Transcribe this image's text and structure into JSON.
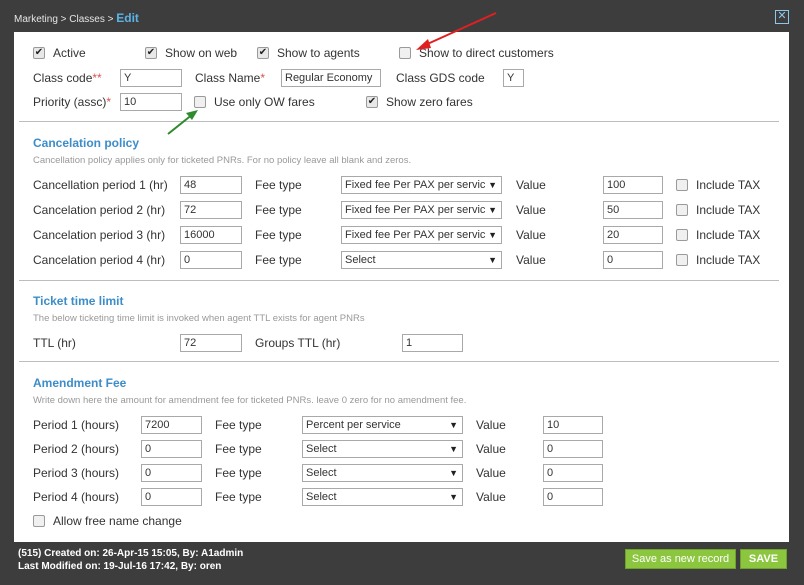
{
  "breadcrumb": {
    "path": "Marketing > Classes > ",
    "current": "Edit"
  },
  "flags": {
    "active": "Active",
    "show_on_web": "Show on web",
    "show_to_agents": "Show to agents",
    "show_to_direct": "Show to direct customers"
  },
  "class_info": {
    "class_code_label": "Class code",
    "class_code_req": "**",
    "class_code_value": "Y",
    "class_name_label": "Class Name",
    "class_name_req": "*",
    "class_name_value": "Regular Economy",
    "gds_label": "Class GDS code",
    "gds_value": "Y",
    "priority_label": "Priority (assc)",
    "priority_req": "*",
    "priority_value": "10",
    "ow_label": "Use only OW fares",
    "zero_label": "Show zero fares"
  },
  "cancellation": {
    "title": "Cancelation policy",
    "note": "Cancellation policy applies only for ticketed PNRs. For no policy leave all blank and zeros.",
    "fee_label": "Fee type",
    "value_label": "Value",
    "tax_label": "Include TAX",
    "rows": [
      {
        "label": "Cancellation period 1 (hr)",
        "period": "48",
        "fee": "Fixed fee Per PAX per servic",
        "value": "100"
      },
      {
        "label": "Cancelation period 2 (hr)",
        "period": "72",
        "fee": "Fixed fee Per PAX per servic",
        "value": "50"
      },
      {
        "label": "Cancelation period 3 (hr)",
        "period": "16000",
        "fee": "Fixed fee Per PAX per servic",
        "value": "20"
      },
      {
        "label": "Cancelation period 4 (hr)",
        "period": "0",
        "fee": "Select",
        "value": "0"
      }
    ]
  },
  "ttl": {
    "title": "Ticket time limit",
    "note": "The below ticketing time limit is invoked when agent TTL exists for agent PNRs",
    "ttl_label": "TTL (hr)",
    "ttl_value": "72",
    "groups_label": "Groups TTL (hr)",
    "groups_value": "1"
  },
  "amendment": {
    "title": "Amendment Fee",
    "note": "Write down here the amount for amendment fee for ticketed PNRs. leave 0 zero for no amendment fee.",
    "fee_label": "Fee type",
    "value_label": "Value",
    "rows": [
      {
        "label": "Period 1 (hours)",
        "period": "7200",
        "fee": "Percent per service",
        "value": "10"
      },
      {
        "label": "Period 2 (hours)",
        "period": "0",
        "fee": "Select",
        "value": "0"
      },
      {
        "label": "Period 3 (hours)",
        "period": "0",
        "fee": "Select",
        "value": "0"
      },
      {
        "label": "Period 4 (hours)",
        "period": "0",
        "fee": "Select",
        "value": "0"
      }
    ],
    "free_name": "Allow free name change"
  },
  "footer": {
    "created": "(515) Created on: 26-Apr-15 15:05, By: A1admin",
    "modified": "Last Modified on: 19-Jul-16 17:42, By: oren",
    "save_new": "Save as new record",
    "save": "SAVE"
  },
  "colors": {
    "accent": "#3c8dc8",
    "required": "#d9534f",
    "button": "#8cc63f",
    "annotation_red": "#e02020",
    "annotation_green": "#2e8b2e"
  },
  "check_glyph": "✔",
  "arrow_glyph": "▼",
  "close_glyph": "✕"
}
